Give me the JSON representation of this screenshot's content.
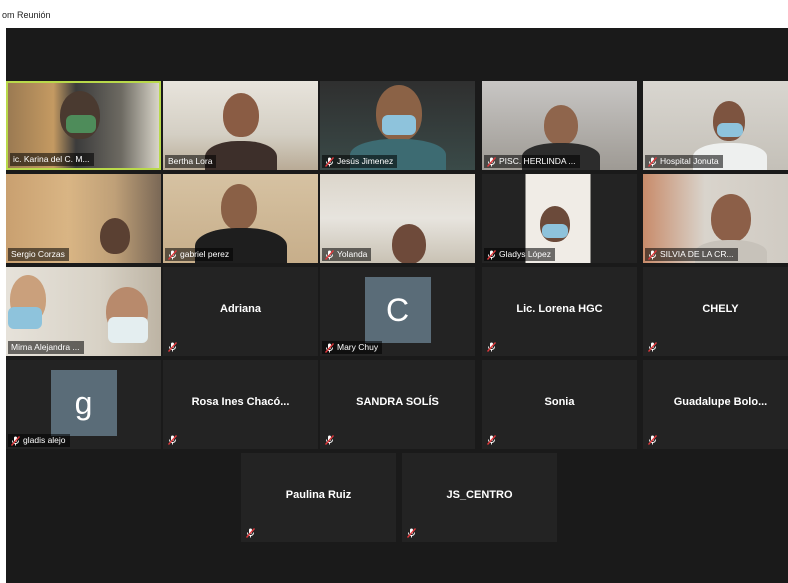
{
  "window": {
    "title": "om Reunión"
  },
  "colors": {
    "active_border": "#b9d94a",
    "tile_bg": "#232323",
    "stage_bg": "#1a1a1a",
    "avatar_bg": "#5a6c78",
    "muted_mic": "#e0383c"
  },
  "participants": [
    {
      "label": "ic. Karina del C. M...",
      "video": true,
      "active": true
    },
    {
      "label": "Bertha Lora",
      "video": true,
      "muted": false
    },
    {
      "label": "Jesús Jimenez",
      "video": true,
      "muted": true
    },
    {
      "label": "PISC. HERLINDA ...",
      "video": true,
      "muted": true
    },
    {
      "label": "Hospital Jonuta",
      "video": true,
      "muted": true
    },
    {
      "label": "Sergio Corzas",
      "video": true,
      "muted": false
    },
    {
      "label": "gabriel perez",
      "video": true,
      "muted": true
    },
    {
      "label": "Yolanda",
      "video": true,
      "muted": true
    },
    {
      "label": "Gladys López",
      "video": true,
      "muted": true
    },
    {
      "label": "SILVIA DE LA CR...",
      "video": true,
      "muted": true
    },
    {
      "label": "Mirna Alejandra ...",
      "video": true,
      "muted": false
    },
    {
      "name": "Adriana",
      "video": false,
      "muted": true
    },
    {
      "label": "Mary Chuy",
      "avatar_letter": "C",
      "video": false,
      "muted": true
    },
    {
      "name": "Lic. Lorena HGC",
      "video": false,
      "muted": true
    },
    {
      "name": "CHELY",
      "video": false,
      "muted": true
    },
    {
      "label": "gladis alejo",
      "avatar_letter": "g",
      "video": false,
      "muted": true
    },
    {
      "name": "Rosa Ines Chacó...",
      "video": false,
      "muted": true
    },
    {
      "name": "SANDRA SOLÍS",
      "video": false,
      "muted": true
    },
    {
      "name": "Sonia",
      "video": false,
      "muted": true
    },
    {
      "name": "Guadalupe  Bolo...",
      "video": false,
      "muted": true
    },
    {
      "name": "Paulina Ruiz",
      "video": false,
      "muted": true
    },
    {
      "name": "JS_CENTRO",
      "video": false,
      "muted": true
    }
  ]
}
